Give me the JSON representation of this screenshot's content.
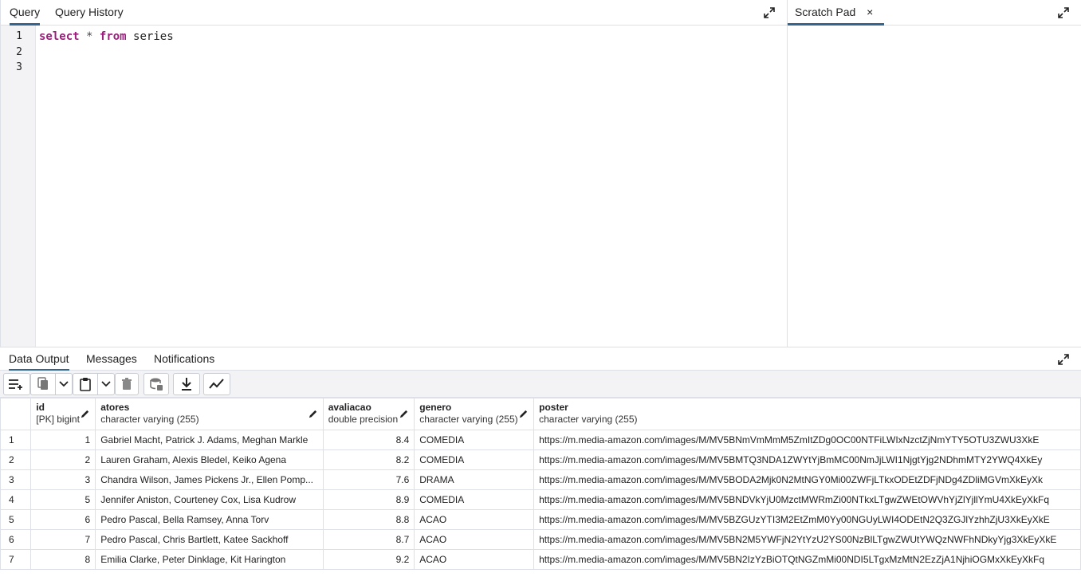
{
  "query_tabs": [
    {
      "label": "Query",
      "active": true
    },
    {
      "label": "Query History",
      "active": false
    }
  ],
  "scratch_tab": {
    "label": "Scratch Pad",
    "close": "×"
  },
  "editor": {
    "line_numbers": [
      "1",
      "2",
      "3"
    ],
    "code": {
      "kw1": "select",
      "op": "*",
      "kw2": "from",
      "table": "series"
    }
  },
  "output_tabs": [
    {
      "label": "Data Output",
      "active": true
    },
    {
      "label": "Messages",
      "active": false
    },
    {
      "label": "Notifications",
      "active": false
    }
  ],
  "toolbar_icons": [
    "add-row-icon",
    "copy-icon",
    "chevron-down-icon",
    "paste-icon",
    "chevron-down-icon",
    "delete-icon",
    "save-data-icon",
    "download-icon",
    "graph-icon"
  ],
  "columns": [
    {
      "name": "id",
      "type": "[PK] bigint"
    },
    {
      "name": "atores",
      "type": "character varying (255)"
    },
    {
      "name": "avaliacao",
      "type": "double precision"
    },
    {
      "name": "genero",
      "type": "character varying (255)"
    },
    {
      "name": "poster",
      "type": "character varying (255)"
    }
  ],
  "rows": [
    {
      "n": "1",
      "id": "1",
      "atores": "Gabriel Macht, Patrick J. Adams, Meghan Markle",
      "avaliacao": "8.4",
      "genero": "COMEDIA",
      "poster": "https://m.media-amazon.com/images/M/MV5BNmVmMmM5ZmItZDg0OC00NTFiLWIxNzctZjNmYTY5OTU3ZWU3XkE"
    },
    {
      "n": "2",
      "id": "2",
      "atores": "Lauren Graham, Alexis Bledel, Keiko Agena",
      "avaliacao": "8.2",
      "genero": "COMEDIA",
      "poster": "https://m.media-amazon.com/images/M/MV5BMTQ3NDA1ZWYtYjBmMC00NmJjLWI1NjgtYjg2NDhmMTY2YWQ4XkEy"
    },
    {
      "n": "3",
      "id": "3",
      "atores": "Chandra Wilson, James Pickens Jr., Ellen Pomp...",
      "avaliacao": "7.6",
      "genero": "DRAMA",
      "poster": "https://m.media-amazon.com/images/M/MV5BODA2Mjk0N2MtNGY0Mi00ZWFjLTkxODEtZDFjNDg4ZDliMGVmXkEyXk"
    },
    {
      "n": "4",
      "id": "5",
      "atores": "Jennifer Aniston, Courteney Cox, Lisa Kudrow",
      "avaliacao": "8.9",
      "genero": "COMEDIA",
      "poster": "https://m.media-amazon.com/images/M/MV5BNDVkYjU0MzctMWRmZi00NTkxLTgwZWEtOWVhYjZlYjllYmU4XkEyXkFq"
    },
    {
      "n": "5",
      "id": "6",
      "atores": "Pedro Pascal, Bella Ramsey, Anna Torv",
      "avaliacao": "8.8",
      "genero": "ACAO",
      "poster": "https://m.media-amazon.com/images/M/MV5BZGUzYTI3M2EtZmM0Yy00NGUyLWI4ODEtN2Q3ZGJlYzhhZjU3XkEyXkE"
    },
    {
      "n": "6",
      "id": "7",
      "atores": "Pedro Pascal, Chris Bartlett, Katee Sackhoff",
      "avaliacao": "8.7",
      "genero": "ACAO",
      "poster": "https://m.media-amazon.com/images/M/MV5BN2M5YWFjN2YtYzU2YS00NzBlLTgwZWUtYWQzNWFhNDkyYjg3XkEyXkE"
    },
    {
      "n": "7",
      "id": "8",
      "atores": "Emilia Clarke, Peter Dinklage, Kit Harington",
      "avaliacao": "9.2",
      "genero": "ACAO",
      "poster": "https://m.media-amazon.com/images/M/MV5BN2IzYzBiOTQtNGZmMi00NDI5LTgxMzMtN2EzZjA1NjhiOGMxXkEyXkFq"
    }
  ]
}
